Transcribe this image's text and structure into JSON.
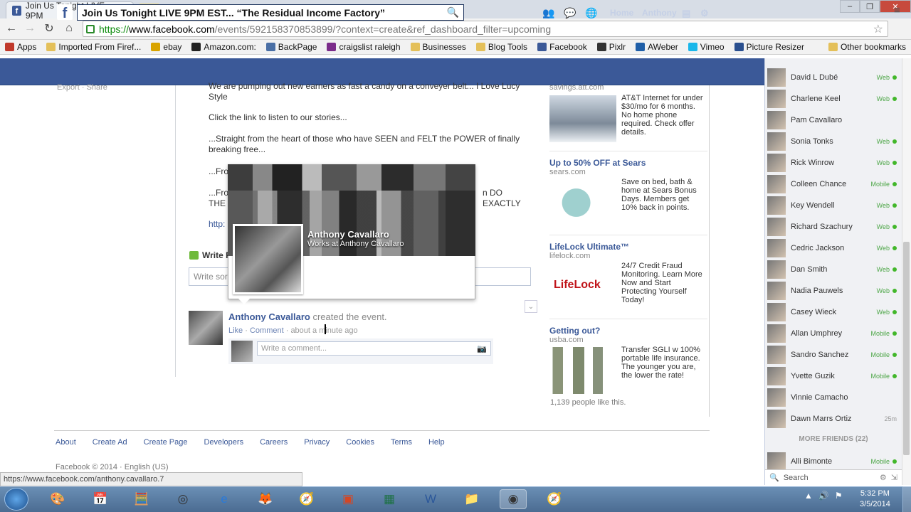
{
  "browser": {
    "tab_title": "Join Us Tonight LIVE 9PM",
    "url_scheme": "https://",
    "url_host": "www.facebook.com",
    "url_path": "/events/592158370853899/?context=create&ref_dashboard_filter=upcoming",
    "bookmarks": [
      {
        "label": "Apps",
        "icon": "apps-grid-icon",
        "color": "#c0392b"
      },
      {
        "label": "Imported From Firef...",
        "icon": "folder-icon",
        "color": "#e4c05a"
      },
      {
        "label": "ebay",
        "icon": "ebay-icon",
        "color": "#d9a400"
      },
      {
        "label": "Amazon.com:",
        "icon": "amazon-icon",
        "color": "#222222"
      },
      {
        "label": "BackPage",
        "icon": "backpage-icon",
        "color": "#4a6fa5"
      },
      {
        "label": "craigslist raleigh",
        "icon": "craigslist-icon",
        "color": "#7b2c8a"
      },
      {
        "label": "Businesses",
        "icon": "folder-icon",
        "color": "#e4c05a"
      },
      {
        "label": "Blog Tools",
        "icon": "folder-icon",
        "color": "#e4c05a"
      },
      {
        "label": "Facebook",
        "icon": "facebook-icon",
        "color": "#3b5998"
      },
      {
        "label": "Pixlr",
        "icon": "pixlr-icon",
        "color": "#333333"
      },
      {
        "label": "AWeber",
        "icon": "aweber-icon",
        "color": "#1f5fa8"
      },
      {
        "label": "Vimeo",
        "icon": "vimeo-icon",
        "color": "#1ab7ea"
      },
      {
        "label": "Picture Resizer",
        "icon": "resizer-icon",
        "color": "#2a4f8f"
      }
    ],
    "other_bookmarks": "Other bookmarks",
    "status_url": "https://www.facebook.com/anthony.cavallaro.7"
  },
  "fb": {
    "search_value": "Join Us Tonight LIVE  9PM EST... “The Residual Income Factory”",
    "nav_home": "Home",
    "nav_name": "Anthony",
    "top_cut_left": "Export · Share",
    "post_lines": [
      "We are pumping out new earners as fast a candy on a conveyer belt... I Love Lucy Style",
      "Click the link to listen to our stories...",
      "...Straight from the heart of those who have SEEN and FELT the POWER of finally breaking free...",
      "...Fro",
      "...Fro",
      "THE",
      "http:"
    ],
    "post_line_tail": "n DO EXACTLY",
    "write_post_label": "Write P",
    "write_box_placeholder": "Write sor",
    "activity_author": "Anthony Cavallaro",
    "activity_text": " created the event.",
    "meta_like": "Like",
    "meta_comment": "Comment",
    "meta_time": "about a minute ago",
    "comment_placeholder": "Write a comment..."
  },
  "hovercard": {
    "name": "Anthony Cavallaro",
    "subtitle": "Works at Anthony Cavallaro"
  },
  "ads": {
    "top_cut": "savings.att.com",
    "att_text": "AT&T Internet for under $30/mo for 6 months. No home phone required. Check offer details.",
    "sears_title": "Up to 50% OFF at Sears",
    "sears_src": "sears.com",
    "sears_text": "Save on bed, bath & home at Sears Bonus Days. Members get 10% back in points.",
    "lifelock_title": "LifeLock Ultimate™",
    "lifelock_src": "lifelock.com",
    "lifelock_logo": "LifeLock",
    "lifelock_text": "24/7 Credit Fraud Monitoring. Learn More Now and Start Protecting Yourself Today!",
    "usba_title": "Getting out?",
    "usba_src": "usba.com",
    "usba_text": "Transfer SGLI w 100% portable life insurance. The younger you are, the lower the rate!",
    "usba_likes": "1,139 people like this."
  },
  "footer": {
    "links": [
      "About",
      "Create Ad",
      "Create Page",
      "Developers",
      "Careers",
      "Privacy",
      "Cookies",
      "Terms",
      "Help"
    ],
    "copyright": "Facebook © 2014 · English (US)"
  },
  "chat": {
    "friends": [
      {
        "name": "David L Dubé",
        "status": "Web"
      },
      {
        "name": "Charlene Keel",
        "status": "Web"
      },
      {
        "name": "Pam Cavallaro",
        "status": ""
      },
      {
        "name": "Sonia Tonks",
        "status": "Web"
      },
      {
        "name": "Rick Winrow",
        "status": "Web"
      },
      {
        "name": "Colleen Chance",
        "status": "Mobile"
      },
      {
        "name": "Key Wendell",
        "status": "Web"
      },
      {
        "name": "Richard Szachury",
        "status": "Web"
      },
      {
        "name": "Cedric Jackson",
        "status": "Web"
      },
      {
        "name": "Dan Smith",
        "status": "Web"
      },
      {
        "name": "Nadia Pauwels",
        "status": "Web"
      },
      {
        "name": "Casey Wieck",
        "status": "Web"
      },
      {
        "name": "Allan Umphrey",
        "status": "Mobile"
      },
      {
        "name": "Sandro Sanchez",
        "status": "Mobile"
      },
      {
        "name": "Yvette Guzik",
        "status": "Mobile"
      },
      {
        "name": "Vinnie Camacho",
        "status": ""
      },
      {
        "name": "Dawn Marrs Ortiz",
        "status": "25m"
      }
    ],
    "more_friends": "MORE FRIENDS (22)",
    "extra_friend": {
      "name": "Alli Bimonte",
      "status": "Mobile"
    },
    "search_label": "Search"
  },
  "taskbar": {
    "time": "5:32 PM",
    "date": "3/5/2014"
  },
  "colors": {
    "fb_blue": "#3b5998",
    "online_green": "#42b72a"
  }
}
